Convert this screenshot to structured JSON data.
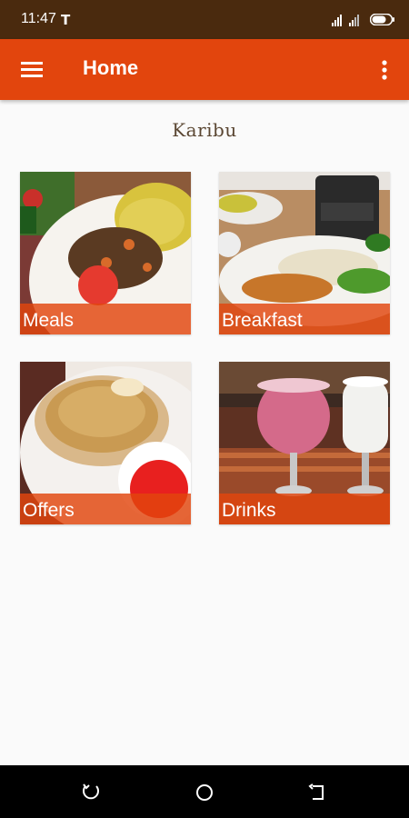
{
  "status_bar": {
    "time": "11:47",
    "app_icon_glyph": "T",
    "background": "#4a2a0e"
  },
  "app_bar": {
    "title": "Home",
    "background": "#e2450d",
    "menu_icon": "hamburger-menu-icon",
    "overflow_icon": "more-vert-icon"
  },
  "greeting": "Karibu",
  "categories": [
    {
      "label": "Meals"
    },
    {
      "label": "Breakfast"
    },
    {
      "label": "Offers"
    },
    {
      "label": "Drinks"
    }
  ],
  "nav_bar": {
    "buttons": [
      "recent-apps-icon",
      "home-icon",
      "back-icon"
    ]
  },
  "colors": {
    "accent": "#e2450d",
    "caption_overlay": "#e2450d",
    "page_background": "#fafafa"
  }
}
